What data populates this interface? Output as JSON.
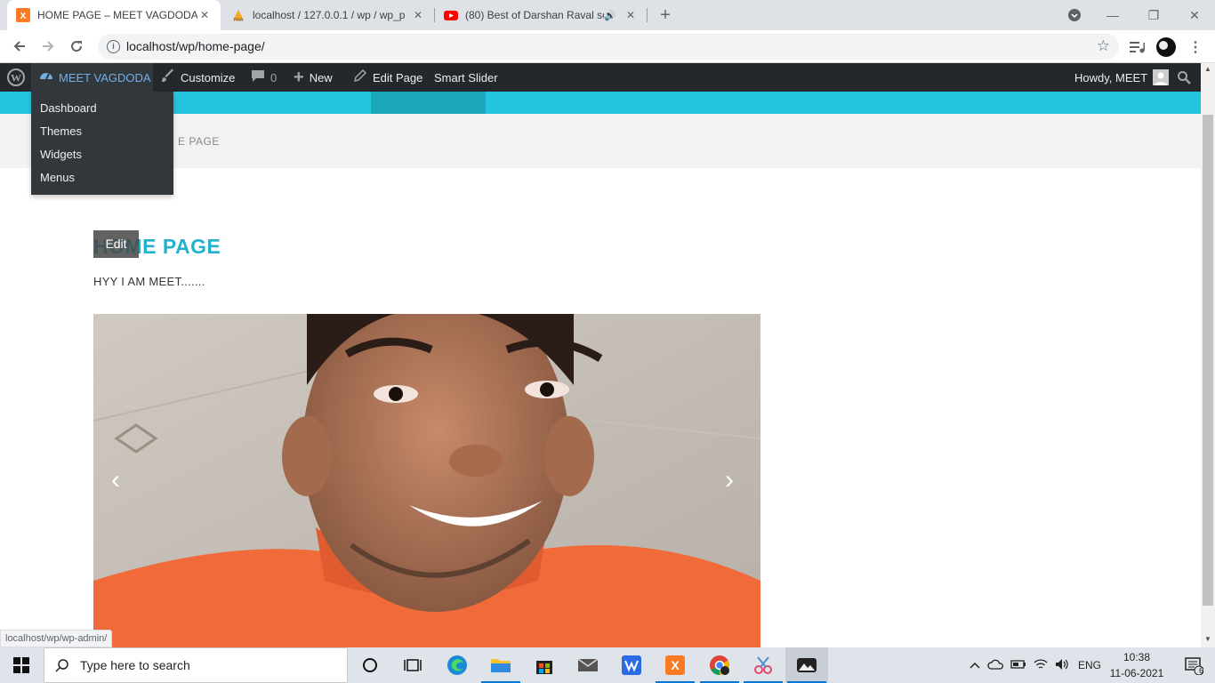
{
  "tabs": [
    {
      "title": "HOME PAGE – MEET VAGDODA",
      "active": true
    },
    {
      "title": "localhost / 127.0.0.1 / wp / wp_p",
      "active": false
    },
    {
      "title": "(80) Best of Darshan Raval so",
      "active": false
    }
  ],
  "toolbar": {
    "url": "localhost/wp/home-page/"
  },
  "adminbar": {
    "site_name": "MEET VAGDODA",
    "customize": "Customize",
    "comments_count": "0",
    "new": "New",
    "edit_page": "Edit Page",
    "smart_slider": "Smart Slider",
    "howdy": "Howdy, MEET"
  },
  "submenu": [
    "Dashboard",
    "Themes",
    "Widgets",
    "Menus"
  ],
  "page": {
    "breadcrumb": "E PAGE",
    "title": "HOME PAGE",
    "edit_label": "Edit",
    "paragraph": "HYY I AM MEET.......",
    "slider_prev": "‹",
    "slider_next": "›"
  },
  "status_link": "localhost/wp/wp-admin/",
  "taskbar": {
    "search_placeholder": "Type here to search",
    "lang": "ENG",
    "time": "10:38",
    "date": "11-06-2021",
    "notifications": "6"
  },
  "colors": {
    "teal": "#22c5dd",
    "adminbar": "#23282d",
    "title": "#22b2cd"
  }
}
